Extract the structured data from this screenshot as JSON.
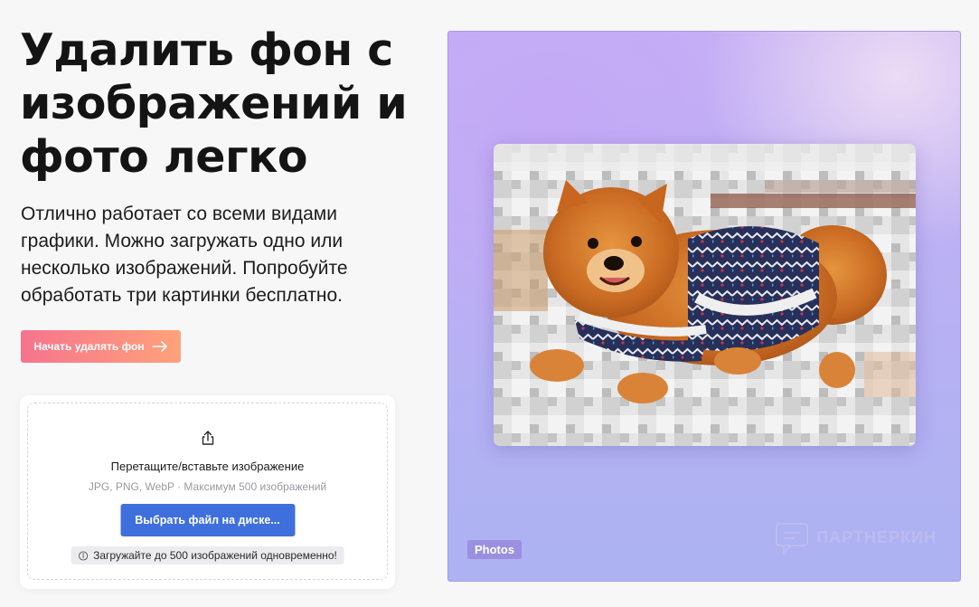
{
  "hero": {
    "title_line1": "Удалить фон с",
    "title_line2": "изображений и",
    "title_line3": "фото легко",
    "description": "Отлично работает со всеми видами графики. Можно загружать одно или несколько изображений. Попробуйте обработать три картинки бесплатно.",
    "cta_label": "Начать удалять фон"
  },
  "upload": {
    "icon": "upload-icon",
    "title": "Перетащите/вставьте изображение",
    "hint": "JPG, PNG, WebP · Максимум 500 изображений",
    "button_label": "Выбрать файл на диске...",
    "note": "Загружайте до 500 изображений одновременно!"
  },
  "preview": {
    "badge": "Photos",
    "watermark": "ПАРТНЕРКИН"
  },
  "colors": {
    "cta_gradient_start": "#f6748e",
    "cta_gradient_end": "#ffa27a",
    "primary_button": "#3f6fdc",
    "preview_background": "#b9b0f4"
  }
}
